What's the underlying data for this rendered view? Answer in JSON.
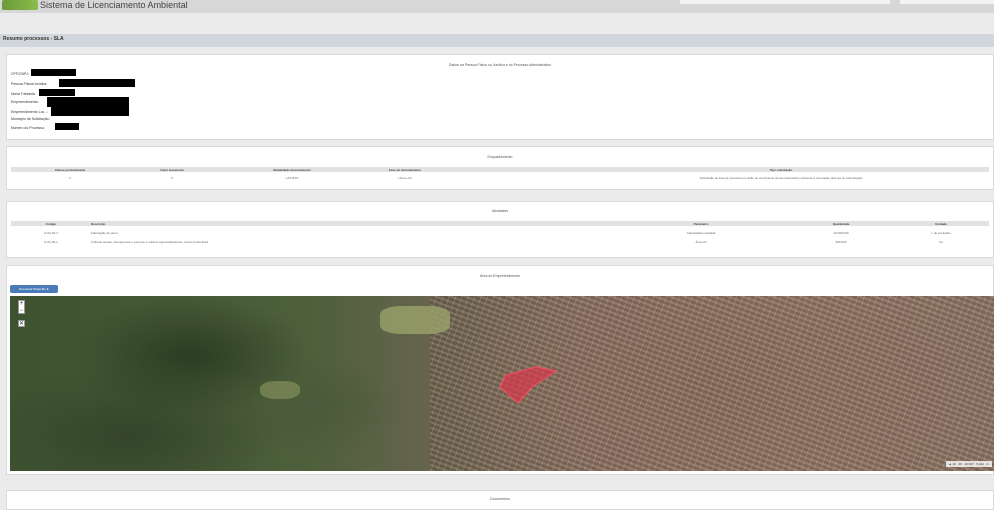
{
  "header": {
    "app_title": "Sistema de Licenciamento Ambiental"
  },
  "section": {
    "title": "Resumo processos - SLA"
  },
  "person_card": {
    "title": "Dados da Pessoa Física ou Jurídica e do Processo Administrativo",
    "fields": {
      "cpf": "CPF/CNPJ:",
      "pessoa": "Pessoa Física/Jurídica:",
      "nome_fantasia": "Nome Fantasia:",
      "empreendimento": "Empreendimento:",
      "empreendimento_loc": "Empreendimento Loc...:",
      "municipio": "Município de Solicitação:",
      "numero": "Número do Processo:"
    }
  },
  "enquadramento": {
    "title": "Enquadramento",
    "headers": [
      "Classe predominante",
      "Fator locacional",
      "Modalidade licenciamento",
      "Fase do licenciamento",
      "Tipo solicitação"
    ],
    "row": [
      "3",
      "0",
      "LAS RAS",
      "LP+LI+LO",
      "Solicitação de licença corretiva em razão do vencimento de ato autorizativo referente à renovação (licença ou autorização)"
    ]
  },
  "atividades": {
    "title": "Atividades",
    "headers": [
      "Código",
      "Descrição",
      "Parâmetro",
      "Quantidade",
      "Unidade"
    ],
    "rows": [
      [
        "D-02-03-4",
        "Fabricação de pisos",
        "Capacidade instalada",
        "10.000,000",
        "L de produção"
      ],
      [
        "G-01-03-1",
        "Culturas anuais, semiperenes e perenes e cultivos agrossilvipastoris, exceto horticultura",
        "Área útil",
        "500,000",
        "ha"
      ]
    ]
  },
  "mapa": {
    "title": "Área do Empreendimento",
    "download_label": "Download Shapefile",
    "zoom_in": "+",
    "zoom_out": "−",
    "fullscreen": "✕",
    "attribution": "▲ 10 · 20 · 10.937 · 5.444 · m"
  },
  "documentos": {
    "title": "Documentos"
  },
  "colors": {
    "accent": "#4a7db8",
    "polygon": "#e0344a"
  }
}
